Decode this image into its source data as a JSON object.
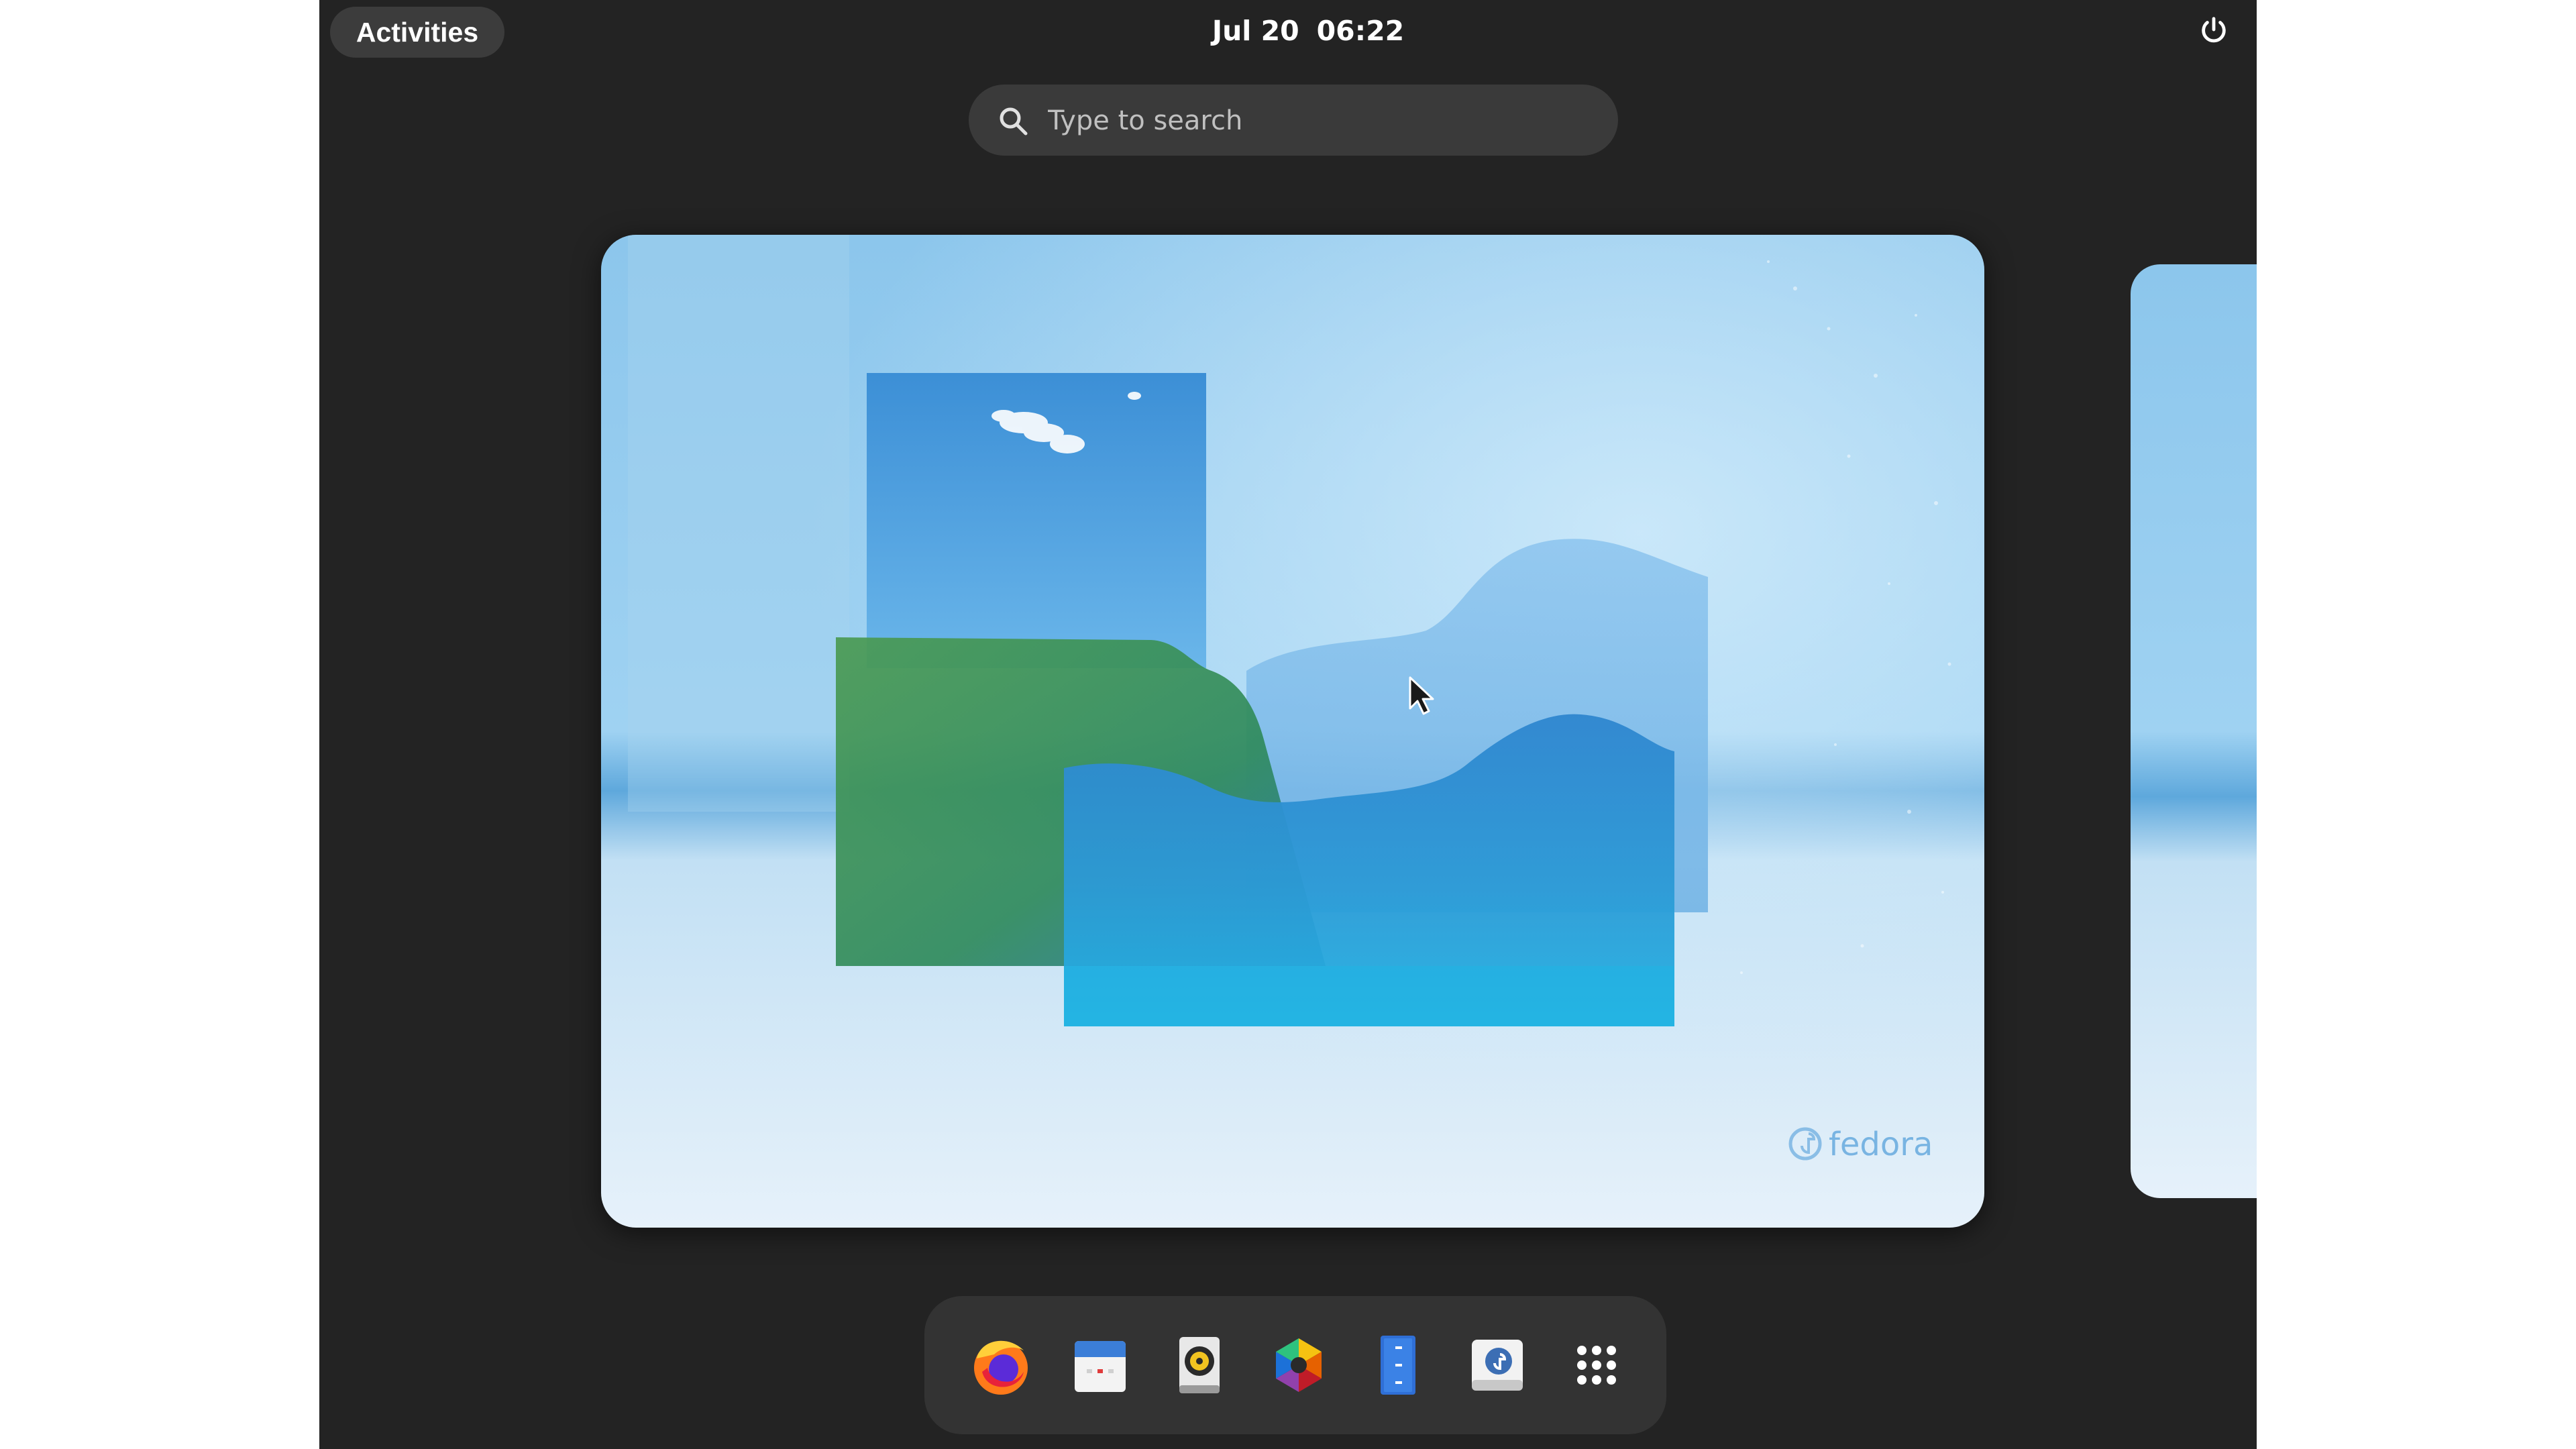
{
  "topbar": {
    "activities_label": "Activities",
    "date": "Jul 20",
    "time": "06:22",
    "power_icon": "power-icon"
  },
  "search": {
    "placeholder": "Type to search",
    "icon": "search-icon"
  },
  "workspace": {
    "watermark": "fedora"
  },
  "dash": {
    "items": [
      {
        "name": "Firefox",
        "icon": "firefox-icon"
      },
      {
        "name": "Calendar",
        "icon": "calendar-icon"
      },
      {
        "name": "Rhythmbox",
        "icon": "rhythmbox-icon"
      },
      {
        "name": "Photos",
        "icon": "photos-icon"
      },
      {
        "name": "Text Editor",
        "icon": "text-editor-icon"
      },
      {
        "name": "Software",
        "icon": "software-icon"
      },
      {
        "name": "Show Apps",
        "icon": "app-grid-icon"
      }
    ]
  },
  "colors": {
    "shell_bg": "#232323",
    "panel_bg": "#3c3c3c",
    "dash_bg": "#333333",
    "wallpaper_sky": "#8cc8ee"
  }
}
